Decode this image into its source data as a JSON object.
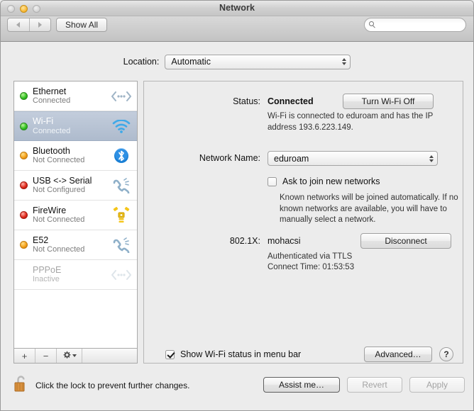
{
  "window": {
    "title": "Network",
    "traffic_lights": [
      "close",
      "minimize",
      "zoom"
    ]
  },
  "toolbar": {
    "back_icon": "triangle-left-icon",
    "forward_icon": "triangle-right-icon",
    "show_all_label": "Show All",
    "search": {
      "value": "",
      "placeholder": "",
      "icon": "search-icon"
    }
  },
  "location": {
    "label": "Location:",
    "value": "Automatic"
  },
  "sidebar": {
    "services": [
      {
        "name": "Ethernet",
        "status": "Connected",
        "dot": "green",
        "icon": "ethernet-icon"
      },
      {
        "name": "Wi-Fi",
        "status": "Connected",
        "dot": "green",
        "icon": "wifi-icon",
        "selected": true
      },
      {
        "name": "Bluetooth",
        "status": "Not Connected",
        "dot": "orange",
        "icon": "bluetooth-icon"
      },
      {
        "name": "USB <-> Serial",
        "status": "Not Configured",
        "dot": "red",
        "icon": "modem-icon"
      },
      {
        "name": "FireWire",
        "status": "Not Connected",
        "dot": "red",
        "icon": "firewire-icon"
      },
      {
        "name": "E52",
        "status": "Not Connected",
        "dot": "orange",
        "icon": "modem-icon"
      },
      {
        "name": "PPPoE",
        "status": "Inactive",
        "dot": "none",
        "icon": "ethernet-icon",
        "dim": true
      }
    ],
    "tools": {
      "add_label": "+",
      "remove_label": "−",
      "action_icon": "gear-icon"
    }
  },
  "main": {
    "status_label": "Status:",
    "status_value": "Connected",
    "turn_wifi_off_label": "Turn Wi-Fi Off",
    "status_detail": "Wi-Fi is connected to eduroam and has the IP address 193.6.223.149.",
    "network_name_label": "Network Name:",
    "network_name_value": "eduroam",
    "ask_to_join_label": "Ask to join new networks",
    "ask_to_join_checked": false,
    "ask_to_join_detail": "Known networks will be joined automatically. If no known networks are available, you will have to manually select a network.",
    "dot1x_label": "802.1X:",
    "dot1x_value": "mohacsi",
    "disconnect_label": "Disconnect",
    "dot1x_auth": "Authenticated via TTLS",
    "dot1x_time": "Connect Time: 01:53:53",
    "show_status_label": "Show Wi-Fi status in menu bar",
    "show_status_checked": true,
    "advanced_label": "Advanced…",
    "help_label": "?"
  },
  "footer": {
    "lock_icon": "unlocked-padlock-icon",
    "lock_text": "Click the lock to prevent further changes.",
    "assist_label": "Assist me…",
    "revert_label": "Revert",
    "apply_label": "Apply"
  }
}
